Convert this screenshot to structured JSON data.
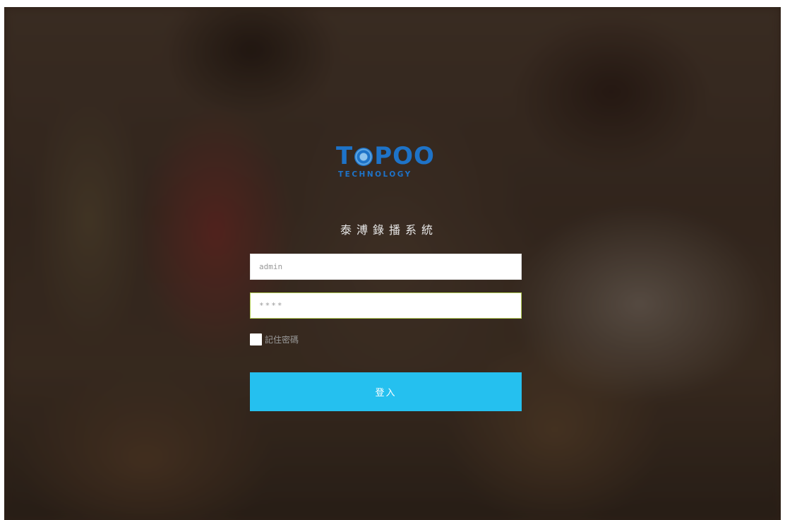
{
  "brand": {
    "logo_main": "T",
    "logo_main_rest": "POO",
    "logo_sub": "TECHNOLOGY",
    "color": "#1e73c8",
    "ring_icon": "swirl-o-icon"
  },
  "system_title": "泰溥錄播系統",
  "login_form": {
    "username_value": "admin",
    "password_value": "****",
    "remember_label": "記住密碼",
    "remember_checked": false,
    "submit_label": "登入",
    "button_color": "#25c0ef"
  }
}
